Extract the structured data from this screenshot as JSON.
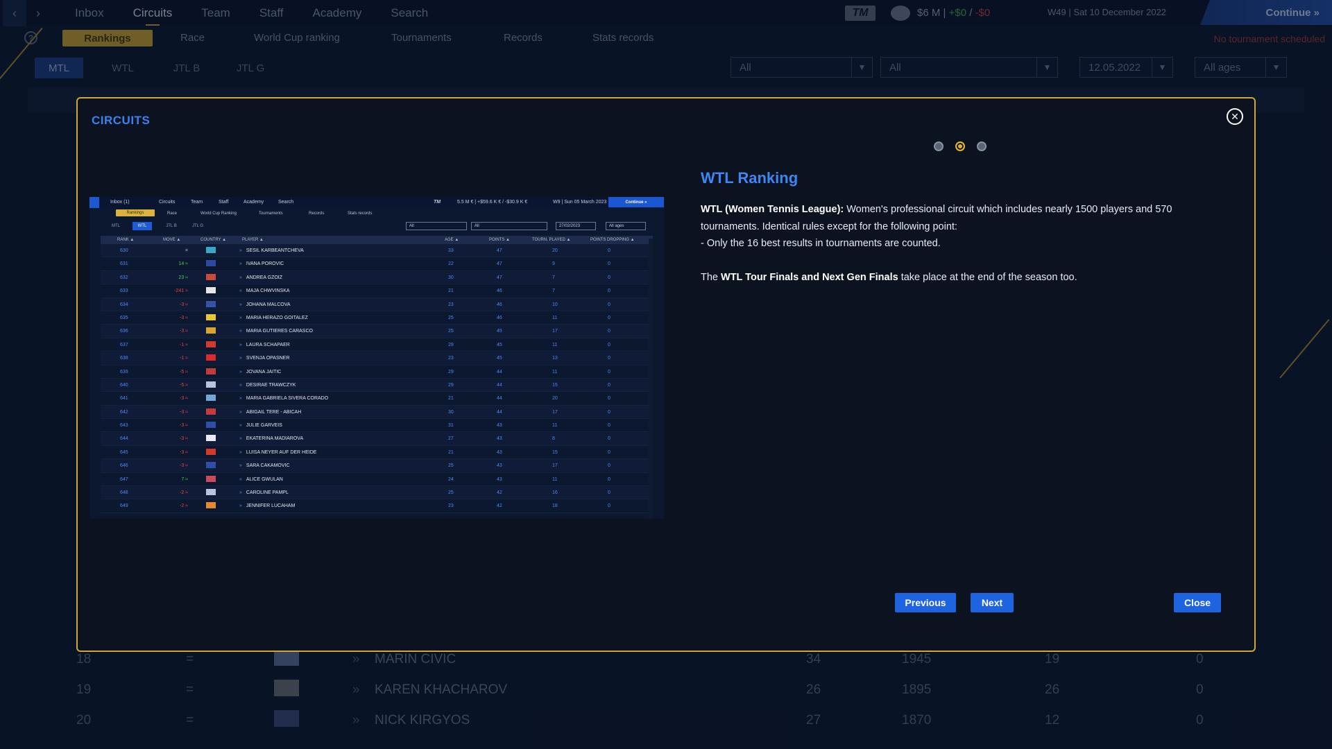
{
  "app": {
    "nav": [
      "Inbox",
      "Circuits",
      "Team",
      "Staff",
      "Academy",
      "Search"
    ],
    "nav_active": "Circuits",
    "logo_text": "TM",
    "money": "$6 M",
    "money_pos": "+$0",
    "money_neg": "-$0",
    "date": "W49 | Sat 10 December 2022",
    "continue": "Continue",
    "subnav": [
      "Rankings",
      "Race",
      "World Cup ranking",
      "Tournaments",
      "Records",
      "Stats records"
    ],
    "no_tournament": "No tournament scheduled",
    "circuit_tabs": [
      "MTL",
      "WTL",
      "JTL B",
      "JTL G"
    ],
    "filters": [
      "All",
      "All",
      "12.05.2022",
      "All ages"
    ],
    "bg_rows": [
      {
        "rank": "18",
        "move": "=",
        "player": "MARIN CIVIC",
        "age": "34",
        "points": "1945",
        "played": "19",
        "dropping": "0"
      },
      {
        "rank": "19",
        "move": "=",
        "player": "KAREN KHACHAROV",
        "age": "26",
        "points": "1895",
        "played": "26",
        "dropping": "0"
      },
      {
        "rank": "20",
        "move": "=",
        "player": "NICK KIRGYOS",
        "age": "27",
        "points": "1870",
        "played": "12",
        "dropping": "0"
      }
    ]
  },
  "modal": {
    "title": "CIRCUITS",
    "page_index": 2,
    "page_count": 3,
    "heading": "WTL Ranking",
    "p1_bold": "WTL (Women Tennis League):",
    "p1_text": " Women's professional circuit which includes nearly 1500 players and 570 tournaments. Identical rules except for the  following point:",
    "p1_line2": "- Only the 16 best results in tournaments are counted.",
    "p2_pre": "The ",
    "p2_bold": "WTL Tour Finals and Next Gen Finals",
    "p2_post": " take place at the end of the season too.",
    "btn_prev": "Previous",
    "btn_next": "Next",
    "btn_close": "Close"
  },
  "mini": {
    "nav": [
      "Inbox (1)",
      "Circuits",
      "Team",
      "Staff",
      "Academy",
      "Search"
    ],
    "logo_text": "TM",
    "money": "5.5 M € | +$59.6 K € / -$30.9 K €",
    "date": "W9 | Sun 05 March 2023",
    "continue": "Continue »",
    "subnav": [
      "Rankings",
      "Race",
      "World Cup Ranking",
      "Tournaments",
      "Records",
      "Stats records"
    ],
    "tabs": [
      "MTL",
      "WTL",
      "JTL B",
      "JTL G"
    ],
    "filters": [
      "All",
      "All",
      "27/02/2023",
      "All ages"
    ],
    "headers": [
      "RANK ▲",
      "MOVE ▲",
      "COUNTRY ▲",
      "PLAYER ▲",
      "AGE ▲",
      "POINTS ▲",
      "TOURN. PLAYED ▲",
      "POINTS DROPPING ▲"
    ],
    "rows": [
      {
        "rank": "630",
        "move": "=",
        "dir": "eq",
        "player": "SESIL KARBEANTCHEVA",
        "age": "33",
        "points": "47",
        "played": "20",
        "drop": "0",
        "flag": "#3aa7c9"
      },
      {
        "rank": "631",
        "move": "14 ≈",
        "dir": "up",
        "player": "IVANA POROVIC",
        "age": "22",
        "points": "47",
        "played": "9",
        "drop": "0",
        "flag": "#2b4aa0"
      },
      {
        "rank": "632",
        "move": "23 ≈",
        "dir": "up",
        "player": "ANDREA GZOIZ",
        "age": "30",
        "points": "47",
        "played": "7",
        "drop": "0",
        "flag": "#c94a3a"
      },
      {
        "rank": "633",
        "move": "-241 ≈",
        "dir": "dn",
        "player": "MAJA CHWVINSKA",
        "age": "21",
        "points": "46",
        "played": "7",
        "drop": "0",
        "flag": "#e6e6e6"
      },
      {
        "rank": "634",
        "move": "-3 ≈",
        "dir": "dn",
        "player": "JOHANA MALCOVA",
        "age": "23",
        "points": "46",
        "played": "10",
        "drop": "0",
        "flag": "#3553a8"
      },
      {
        "rank": "635",
        "move": "-3 ≈",
        "dir": "dn",
        "player": "MARIA HERAZO GOITALEZ",
        "age": "25",
        "points": "46",
        "played": "11",
        "drop": "0",
        "flag": "#e8c531"
      },
      {
        "rank": "636",
        "move": "-3 ≈",
        "dir": "dn",
        "player": "MARIA GUTIERES CARASCO",
        "age": "25",
        "points": "45",
        "played": "17",
        "drop": "0",
        "flag": "#d9a52b"
      },
      {
        "rank": "637",
        "move": "-1 ≈",
        "dir": "dn",
        "player": "LAURA SCHAPAER",
        "age": "29",
        "points": "45",
        "played": "11",
        "drop": "0",
        "flag": "#d43a2b"
      },
      {
        "rank": "638",
        "move": "-1 ≈",
        "dir": "dn",
        "player": "SVENJA OPASNER",
        "age": "23",
        "points": "45",
        "played": "13",
        "drop": "0",
        "flag": "#d92b2b"
      },
      {
        "rank": "639",
        "move": "-5 ≈",
        "dir": "dn",
        "player": "JOVANA JAITIC",
        "age": "29",
        "points": "44",
        "played": "11",
        "drop": "0",
        "flag": "#c23b3b"
      },
      {
        "rank": "640",
        "move": "-5 ≈",
        "dir": "dn",
        "player": "DESIRAE TRAWCZYK",
        "age": "29",
        "points": "44",
        "played": "15",
        "drop": "0",
        "flag": "#b9c3dd"
      },
      {
        "rank": "641",
        "move": "-3 ≈",
        "dir": "dn",
        "player": "MARIA GABRIELA SIVERA CORADO",
        "age": "21",
        "points": "44",
        "played": "20",
        "drop": "0",
        "flag": "#6fa7d8"
      },
      {
        "rank": "642",
        "move": "-3 ≈",
        "dir": "dn",
        "player": "ABIGAIL TERE - ABICAH",
        "age": "30",
        "points": "44",
        "played": "17",
        "drop": "0",
        "flag": "#c93a3a"
      },
      {
        "rank": "643",
        "move": "-3 ≈",
        "dir": "dn",
        "player": "JULIE GARVEIS",
        "age": "31",
        "points": "43",
        "played": "11",
        "drop": "0",
        "flag": "#2f4ea8"
      },
      {
        "rank": "644",
        "move": "-3 ≈",
        "dir": "dn",
        "player": "EKATERINA MADIAROVA",
        "age": "27",
        "points": "43",
        "played": "8",
        "drop": "0",
        "flag": "#e9e9f2"
      },
      {
        "rank": "645",
        "move": "-3 ≈",
        "dir": "dn",
        "player": "LUISA NEYER AUF DER HEIDE",
        "age": "21",
        "points": "43",
        "played": "15",
        "drop": "0",
        "flag": "#d43a2b"
      },
      {
        "rank": "646",
        "move": "-3 ≈",
        "dir": "dn",
        "player": "SARA CAKAMOVIC",
        "age": "25",
        "points": "43",
        "played": "17",
        "drop": "0",
        "flag": "#2f4ea8"
      },
      {
        "rank": "647",
        "move": "7 ≈",
        "dir": "up",
        "player": "ALICE GWULAN",
        "age": "24",
        "points": "43",
        "played": "11",
        "drop": "0",
        "flag": "#c94a5a"
      },
      {
        "rank": "648",
        "move": "-2 ≈",
        "dir": "dn",
        "player": "CAROLINE PAMPL",
        "age": "25",
        "points": "42",
        "played": "16",
        "drop": "0",
        "flag": "#b9c3dd"
      },
      {
        "rank": "649",
        "move": "-2 ≈",
        "dir": "dn",
        "player": "JENNIFER LUCAHAM",
        "age": "23",
        "points": "42",
        "played": "18",
        "drop": "0",
        "flag": "#e58a2b"
      }
    ]
  },
  "colors": {
    "accent_blue": "#3f86f3",
    "gold": "#cfa83a",
    "button_blue": "#1e63e0"
  }
}
